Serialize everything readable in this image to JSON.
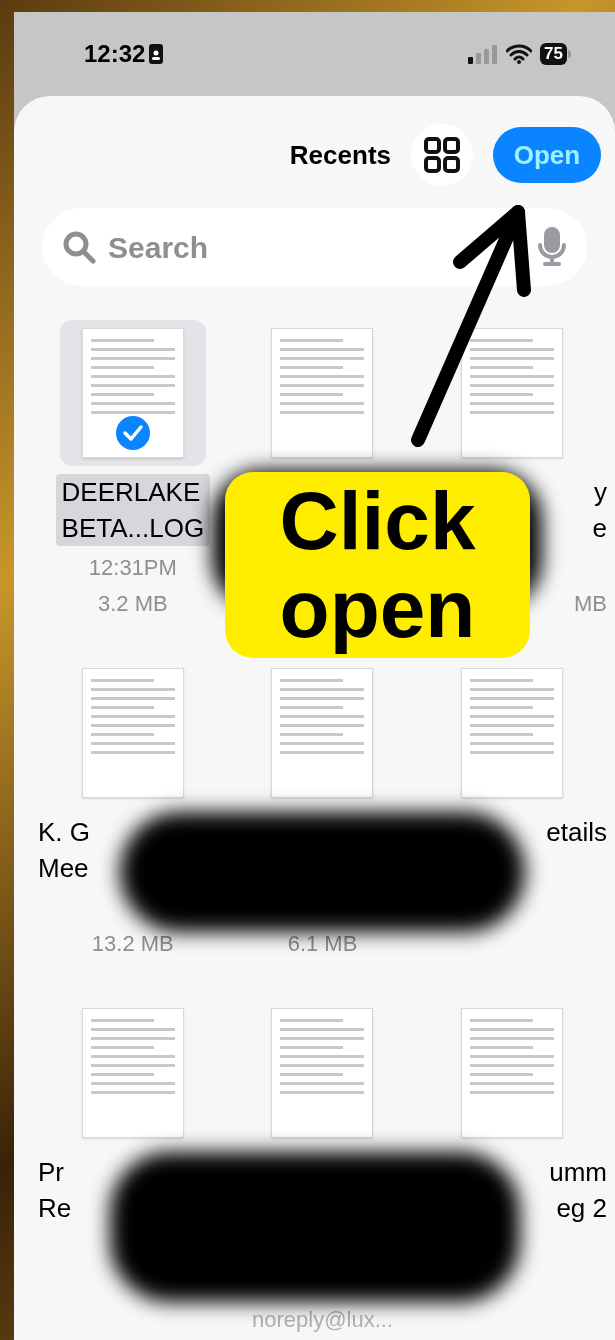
{
  "status_bar": {
    "time": "12:32",
    "battery": "75"
  },
  "header": {
    "title": "Recents",
    "open_button": "Open"
  },
  "search": {
    "placeholder": "Search"
  },
  "files": [
    {
      "selected": true,
      "name_lines": [
        "DEERLAKE",
        "BETA...LOG"
      ],
      "date": "12:31PM",
      "size": "3.2 MB"
    },
    {
      "selected": false
    },
    {
      "selected": false,
      "name_lines": [
        "y",
        "e"
      ],
      "size": "MB"
    },
    {
      "selected": false,
      "name_lines": [
        "K. G",
        "Mee"
      ],
      "size": "13.2 MB"
    },
    {
      "selected": false,
      "size": "6.1 MB"
    },
    {
      "selected": false,
      "name_lines": [
        "etails"
      ]
    },
    {
      "selected": false,
      "name_lines": [
        "Pr",
        "Re"
      ]
    },
    {
      "selected": false,
      "from": "noreply@lux..."
    },
    {
      "selected": false,
      "name_lines": [
        "umm",
        "eg 2"
      ]
    }
  ],
  "callout": {
    "lines": [
      "Click",
      "open"
    ]
  }
}
